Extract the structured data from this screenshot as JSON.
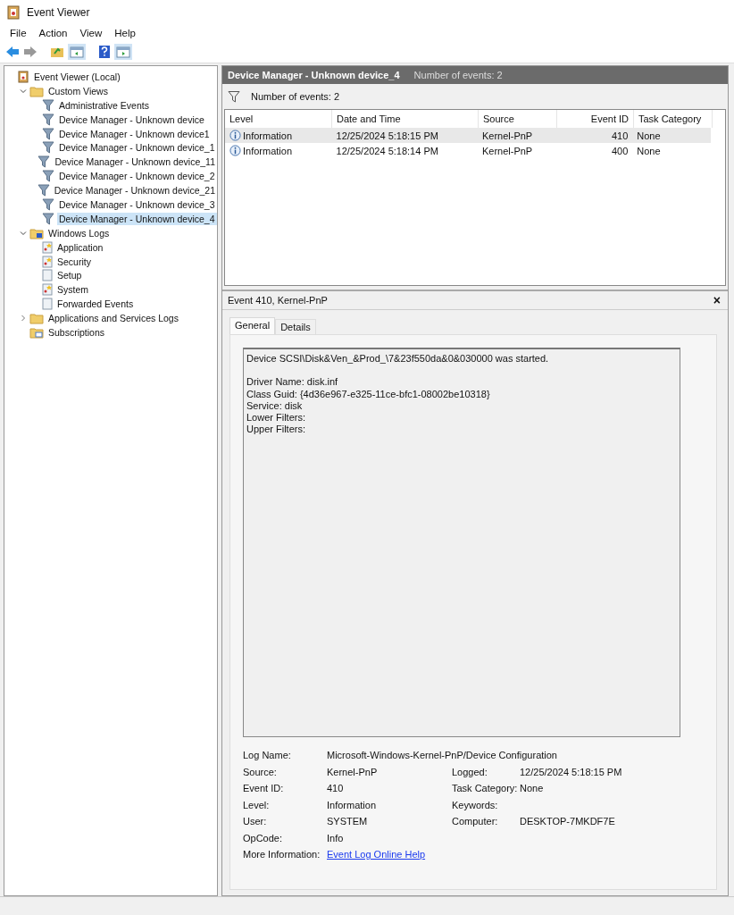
{
  "window": {
    "title": "Event Viewer"
  },
  "menu": [
    "File",
    "Action",
    "View",
    "Help"
  ],
  "toolbar": [
    {
      "kind": "back"
    },
    {
      "kind": "forward"
    },
    {
      "kind": "up"
    },
    {
      "kind": "pane"
    },
    {
      "kind": "help"
    },
    {
      "kind": "pane2"
    }
  ],
  "tree": [
    {
      "label": "Event Viewer (Local)",
      "kind": "root",
      "selected": false,
      "children": [
        {
          "label": "Custom Views",
          "kind": "folder",
          "expanded": true,
          "selected": false,
          "children": [
            {
              "label": "Administrative Events",
              "kind": "filter",
              "selected": false
            },
            {
              "label": "Device Manager - Unknown device",
              "kind": "filter",
              "selected": false
            },
            {
              "label": "Device Manager - Unknown device1",
              "kind": "filter",
              "selected": false
            },
            {
              "label": "Device Manager - Unknown device_1",
              "kind": "filter",
              "selected": false
            },
            {
              "label": "Device Manager - Unknown device_11",
              "kind": "filter",
              "selected": false
            },
            {
              "label": "Device Manager - Unknown device_2",
              "kind": "filter",
              "selected": false
            },
            {
              "label": "Device Manager - Unknown device_21",
              "kind": "filter",
              "selected": false
            },
            {
              "label": "Device Manager - Unknown device_3",
              "kind": "filter",
              "selected": false
            },
            {
              "label": "Device Manager - Unknown device_4",
              "kind": "filter",
              "selected": true
            }
          ]
        },
        {
          "label": "Windows Logs",
          "kind": "logfolder",
          "expanded": true,
          "selected": false,
          "children": [
            {
              "label": "Application",
              "kind": "log",
              "selected": false
            },
            {
              "label": "Security",
              "kind": "log",
              "selected": false
            },
            {
              "label": "Setup",
              "kind": "emptylog",
              "selected": false
            },
            {
              "label": "System",
              "kind": "log",
              "selected": false
            },
            {
              "label": "Forwarded Events",
              "kind": "emptylog",
              "selected": false
            }
          ]
        },
        {
          "label": "Applications and Services Logs",
          "kind": "folder",
          "expanded": false,
          "selected": false
        },
        {
          "label": "Subscriptions",
          "kind": "subs",
          "selected": false
        }
      ]
    }
  ],
  "view": {
    "title": "Device Manager - Unknown device_4",
    "count": "Number of events: 2",
    "filter_label": "Number of events: 2",
    "table": {
      "columns": [
        "Level",
        "Date and Time",
        "Source",
        "Event ID",
        "Task Category"
      ],
      "rows": [
        {
          "selected": true,
          "cells": [
            "Information",
            "12/25/2024 5:18:15 PM",
            "Kernel-PnP",
            "410",
            "None"
          ]
        },
        {
          "selected": false,
          "cells": [
            "Information",
            "12/25/2024 5:18:14 PM",
            "Kernel-PnP",
            "400",
            "None"
          ]
        }
      ]
    }
  },
  "detail": {
    "title": "Event 410, Kernel-PnP",
    "close": "×",
    "tabs": [
      {
        "label": "General",
        "selected": true
      },
      {
        "label": "Details",
        "selected": false
      }
    ],
    "message": [
      [
        "Device SCSI\\Disk&Ven_&Prod_\\7&23f550da&0&030000 was started."
      ],
      [
        "Driver Name: disk.inf",
        "Class Guid: {4d36e967-e325-11ce-bfc1-08002be10318}",
        "Service: disk",
        "Lower Filters:",
        "Upper Filters:"
      ]
    ],
    "fields": [
      {
        "label": "Log Name:",
        "value": "Microsoft-Windows-Kernel-PnP/Device Configuration"
      },
      {
        "label": "Source:",
        "value": "Kernel-PnP",
        "label2": "Logged:",
        "value2": "12/25/2024 5:18:15 PM"
      },
      {
        "label": "Event ID:",
        "value": "410",
        "label2": "Task Category:",
        "value2": "None"
      },
      {
        "label": "Level:",
        "value": "Information",
        "label2": "Keywords:"
      },
      {
        "label": "User:",
        "value": "SYSTEM",
        "label2": "Computer:",
        "value2": "DESKTOP-7MKDF7E"
      },
      {
        "label": "OpCode:",
        "value": "Info"
      },
      {
        "label": "More Information:",
        "value": "Event Log Online Help",
        "kind": "link"
      }
    ]
  }
}
